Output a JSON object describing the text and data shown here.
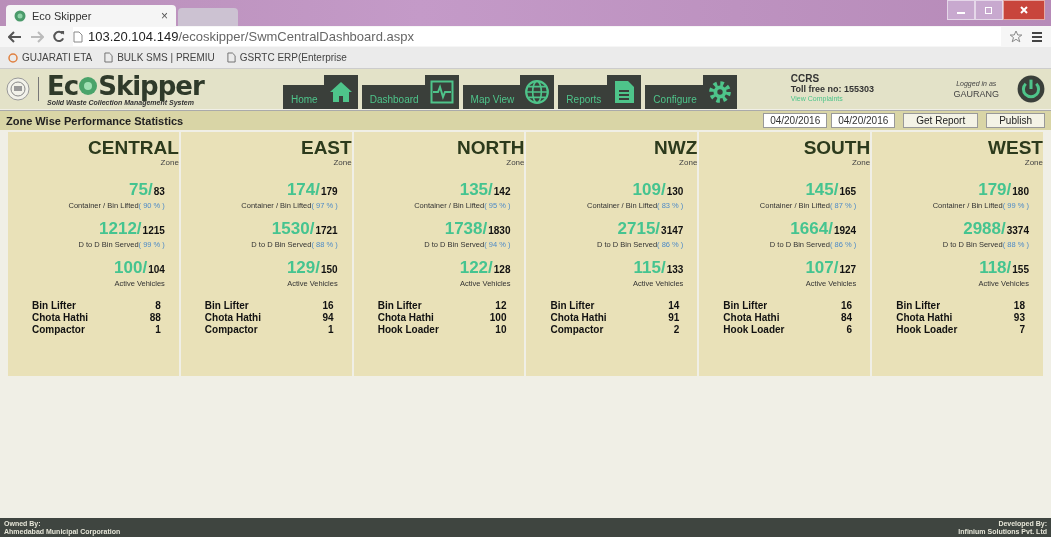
{
  "browser": {
    "tab_title": "Eco Skipper",
    "tab_close": "×",
    "url_host": "103.20.104.149",
    "url_path": "/ecoskipper/SwmCentralDashboard.aspx",
    "bookmarks": [
      "GUJARATI ETA",
      "BULK SMS | PREMIU",
      "GSRTC ERP(Enterprise"
    ]
  },
  "header": {
    "logo_text_1": "Ec",
    "logo_text_2": "Skipper",
    "logo_tagline": "Solid Waste Collection Management System",
    "nav": [
      {
        "label": "Home",
        "kind": "home"
      },
      {
        "label": "Dashboard",
        "kind": "dashboard"
      },
      {
        "label": "Map View",
        "kind": "map"
      },
      {
        "label": "Reports",
        "kind": "reports"
      },
      {
        "label": "Configure",
        "kind": "configure"
      }
    ],
    "ccrs": "CCRS",
    "toll_free": "Toll free no: 155303",
    "complaints_link": "View Complaints",
    "logged_in_label": "Logged in as",
    "user": "GAURANG"
  },
  "toolbar": {
    "title": "Zone Wise Performance Statistics",
    "from_date": "04/20/2016",
    "to_date": "04/20/2016",
    "buttons": [
      "Get Report",
      "Publish"
    ]
  },
  "zones": [
    {
      "name": "CENTRAL",
      "sub": "Zone",
      "metrics": [
        {
          "done": "75/",
          "total": "83",
          "caption": "Container / Bin Lifted",
          "pct": "( 90 % )"
        },
        {
          "done": "1212/",
          "total": "1215",
          "caption": "D to D Bin Served",
          "pct": "( 99 % )"
        },
        {
          "done": "100/",
          "total": "104",
          "caption": "Active Vehicles"
        }
      ],
      "vehicles": [
        {
          "type": "Bin Lifter",
          "count": "8"
        },
        {
          "type": "Chota Hathi",
          "count": "88"
        },
        {
          "type": "Compactor",
          "count": "1"
        }
      ]
    },
    {
      "name": "EAST",
      "sub": "Zone",
      "metrics": [
        {
          "done": "174/",
          "total": "179",
          "caption": "Container / Bin Lifted",
          "pct": "( 97 % )"
        },
        {
          "done": "1530/",
          "total": "1721",
          "caption": "D to D Bin Served",
          "pct": "( 88 % )"
        },
        {
          "done": "129/",
          "total": "150",
          "caption": "Active Vehicles"
        }
      ],
      "vehicles": [
        {
          "type": "Bin Lifter",
          "count": "16"
        },
        {
          "type": "Chota Hathi",
          "count": "94"
        },
        {
          "type": "Compactor",
          "count": "1"
        }
      ]
    },
    {
      "name": "NORTH",
      "sub": "Zone",
      "metrics": [
        {
          "done": "135/",
          "total": "142",
          "caption": "Container / Bin Lifted",
          "pct": "( 95 % )"
        },
        {
          "done": "1738/",
          "total": "1830",
          "caption": "D to D Bin Served",
          "pct": "( 94 % )"
        },
        {
          "done": "122/",
          "total": "128",
          "caption": "Active Vehicles"
        }
      ],
      "vehicles": [
        {
          "type": "Bin Lifter",
          "count": "12"
        },
        {
          "type": "Chota Hathi",
          "count": "100"
        },
        {
          "type": "Hook Loader",
          "count": "10"
        }
      ]
    },
    {
      "name": "NWZ",
      "sub": "Zone",
      "metrics": [
        {
          "done": "109/",
          "total": "130",
          "caption": "Container / Bin Lifted",
          "pct": "( 83 % )"
        },
        {
          "done": "2715/",
          "total": "3147",
          "caption": "D to D Bin Served",
          "pct": "( 86 % )"
        },
        {
          "done": "115/",
          "total": "133",
          "caption": "Active Vehicles"
        }
      ],
      "vehicles": [
        {
          "type": "Bin Lifter",
          "count": "14"
        },
        {
          "type": "Chota Hathi",
          "count": "91"
        },
        {
          "type": "Compactor",
          "count": "2"
        }
      ]
    },
    {
      "name": "SOUTH",
      "sub": "Zone",
      "metrics": [
        {
          "done": "145/",
          "total": "165",
          "caption": "Container / Bin Lifted",
          "pct": "( 87 % )"
        },
        {
          "done": "1664/",
          "total": "1924",
          "caption": "D to D Bin Served",
          "pct": "( 86 % )"
        },
        {
          "done": "107/",
          "total": "127",
          "caption": "Active Vehicles"
        }
      ],
      "vehicles": [
        {
          "type": "Bin Lifter",
          "count": "16"
        },
        {
          "type": "Chota Hathi",
          "count": "84"
        },
        {
          "type": "Hook Loader",
          "count": "6"
        }
      ]
    },
    {
      "name": "WEST",
      "sub": "Zone",
      "metrics": [
        {
          "done": "179/",
          "total": "180",
          "caption": "Container / Bin Lifted",
          "pct": "( 99 % )"
        },
        {
          "done": "2988/",
          "total": "3374",
          "caption": "D to D Bin Served",
          "pct": "( 88 % )"
        },
        {
          "done": "118/",
          "total": "155",
          "caption": "Active Vehicles"
        }
      ],
      "vehicles": [
        {
          "type": "Bin Lifter",
          "count": "18"
        },
        {
          "type": "Chota Hathi",
          "count": "93"
        },
        {
          "type": "Hook Loader",
          "count": "7"
        }
      ]
    }
  ],
  "footer": {
    "owned_label": "Owned By:",
    "owner": "Ahmedabad Municipal Corporation",
    "developed_label": "Developed By:",
    "developer": "Infinium Solutions Pvt. Ltd"
  }
}
